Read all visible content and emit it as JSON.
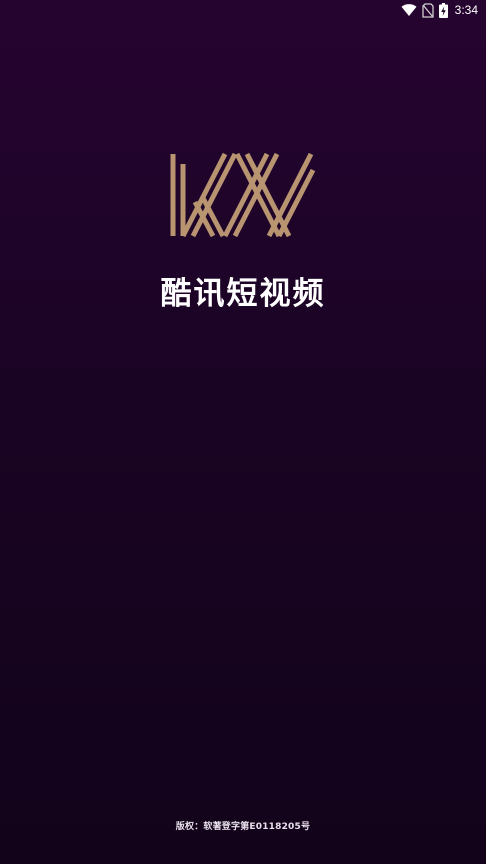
{
  "status_bar": {
    "time": "3:34",
    "icons": [
      "wifi-icon",
      "no-sim-icon",
      "battery-charging-icon"
    ]
  },
  "splash": {
    "logo_text": "KX",
    "app_name": "酷讯短视频",
    "copyright": "版权：软著登字第E0118205号"
  },
  "colors": {
    "background_top": "#260430",
    "background_bottom": "#12031a",
    "logo_gold": "#b89470",
    "text": "#ffffff"
  }
}
